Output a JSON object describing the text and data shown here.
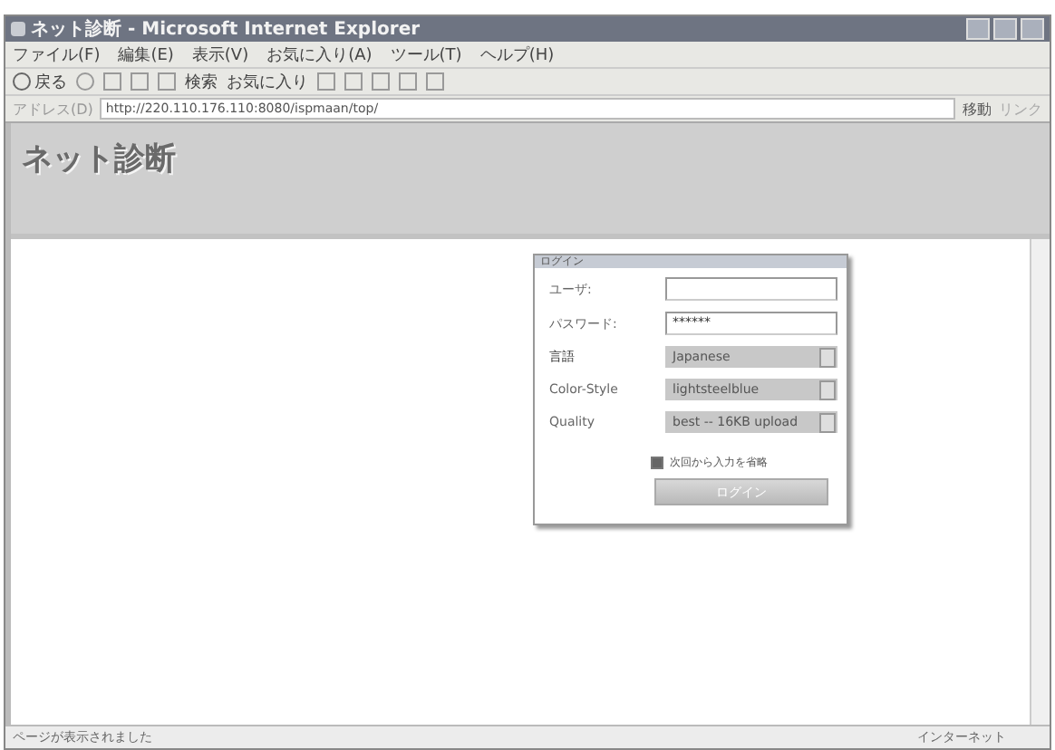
{
  "window": {
    "title": "ネット診断 - Microsoft Internet Explorer"
  },
  "menu": [
    "ファイル(F)",
    "編集(E)",
    "表示(V)",
    "お気に入り(A)",
    "ツール(T)",
    "ヘルプ(H)"
  ],
  "toolbar": {
    "back": "戻る",
    "search": "検索",
    "favorites": "お気に入り"
  },
  "address_bar": {
    "label": "アドレス(D)",
    "value": "http://220.110.176.110:8080/ispmaan/top/",
    "go": "移動",
    "links": "リンク"
  },
  "page": {
    "heading": "ネット診断"
  },
  "login": {
    "title": "ログイン",
    "fields": [
      {
        "kind": "text",
        "label": "ユーザ:"
      },
      {
        "kind": "password",
        "label": "パスワード:",
        "value": "******"
      },
      {
        "kind": "select",
        "label": "言語",
        "value": "Japanese"
      },
      {
        "kind": "select",
        "label": "Color-Style",
        "value": "lightsteelblue"
      },
      {
        "kind": "select",
        "label": "Quality",
        "value": "best -- 16KB upload"
      }
    ],
    "remember": {
      "label": "次回から入力を省略",
      "checked": true
    },
    "button": "ログイン"
  },
  "status_bar": {
    "text": "ページが表示されました",
    "zone": "インターネット"
  }
}
